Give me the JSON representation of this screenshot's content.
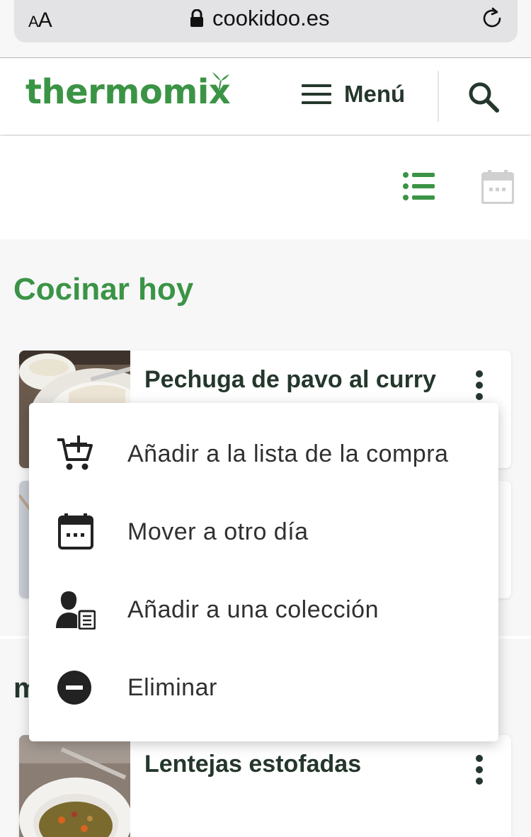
{
  "browser": {
    "aa_label_small": "A",
    "aa_label_big": "A",
    "url": "cookidoo.es",
    "icons": [
      "lock-icon",
      "reload-icon"
    ]
  },
  "header": {
    "logo_text": "thermomix",
    "menu_label": "Menú",
    "icons": [
      "hamburger-icon",
      "search-icon"
    ]
  },
  "view_toggle": {
    "icons": [
      "list-view-icon",
      "calendar-view-icon"
    ],
    "active": "list"
  },
  "sections": {
    "today_title": "Cocinar hoy",
    "next_title_partial": "m"
  },
  "cards": [
    {
      "title": "Pechuga de pavo al curry"
    },
    {
      "title": ""
    },
    {
      "title": "Lentejas estofadas"
    }
  ],
  "context_menu": {
    "items": [
      {
        "label": "Añadir a la lista de la compra",
        "icon": "add-to-cart-icon"
      },
      {
        "label": "Mover a otro día",
        "icon": "calendar-icon"
      },
      {
        "label": "Añadir a una colección",
        "icon": "collection-icon"
      },
      {
        "label": "Eliminar",
        "icon": "remove-icon"
      }
    ]
  },
  "colors": {
    "brand_green": "#3b9445",
    "dark_text": "#25372c",
    "page_bg": "#f7f7f8"
  }
}
